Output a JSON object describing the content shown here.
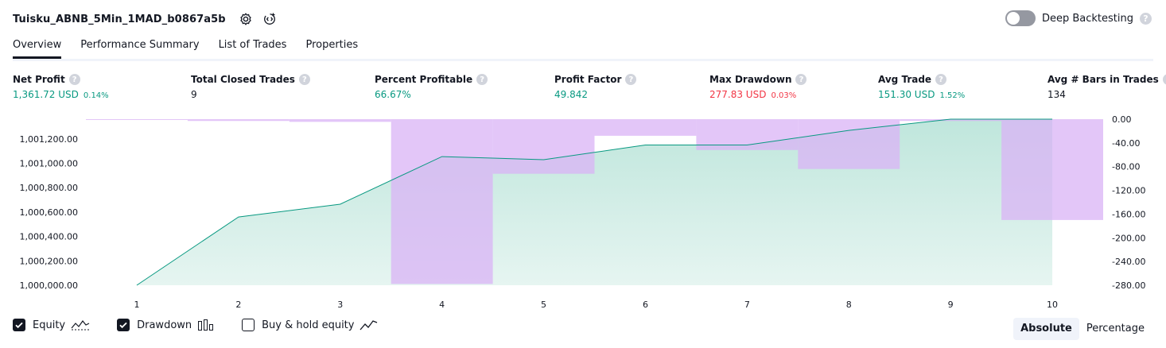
{
  "header": {
    "strategy_name": "Tuisku_ABNB_5Min_1MAD_b0867a5b",
    "deep_backtesting_label": "Deep Backtesting",
    "deep_backtesting_on": false
  },
  "tabs": [
    {
      "label": "Overview",
      "active": true
    },
    {
      "label": "Performance Summary",
      "active": false
    },
    {
      "label": "List of Trades",
      "active": false
    },
    {
      "label": "Properties",
      "active": false
    }
  ],
  "metrics": {
    "net_profit": {
      "label": "Net Profit",
      "value": "1,361.72 USD",
      "pct": "0.14%"
    },
    "total_closed_trades": {
      "label": "Total Closed Trades",
      "value": "9"
    },
    "percent_profitable": {
      "label": "Percent Profitable",
      "value": "66.67%"
    },
    "profit_factor": {
      "label": "Profit Factor",
      "value": "49.842"
    },
    "max_drawdown": {
      "label": "Max Drawdown",
      "value": "277.83 USD",
      "pct": "0.03%"
    },
    "avg_trade": {
      "label": "Avg Trade",
      "value": "151.30 USD",
      "pct": "1.52%"
    },
    "avg_bars": {
      "label": "Avg # Bars in Trades",
      "value": "134"
    }
  },
  "chart_data": {
    "type": "line",
    "x": [
      1,
      2,
      3,
      4,
      5,
      6,
      7,
      8,
      9,
      10
    ],
    "x_ticks": [
      "1",
      "2",
      "3",
      "4",
      "5",
      "6",
      "7",
      "8",
      "9",
      "10"
    ],
    "series": [
      {
        "name": "Equity",
        "type": "area",
        "axis": "left",
        "color": "#089981",
        "values": [
          1000000.0,
          1000560.0,
          1000665.0,
          1001055.0,
          1001030.0,
          1001150.0,
          1001150.0,
          1001270.0,
          1001362.0,
          1001362.0
        ]
      },
      {
        "name": "Drawdown",
        "type": "bar",
        "axis": "right",
        "color": "#ce93d8",
        "values": [
          -0.5,
          -3.0,
          -4.5,
          -277.83,
          -92.0,
          -28.0,
          -52.0,
          -84.0,
          -3.0,
          -170.0
        ]
      }
    ],
    "left_axis": {
      "ticks": [
        "1,000,000.00",
        "1,000,200.00",
        "1,000,400.00",
        "1,000,600.00",
        "1,000,800.00",
        "1,001,000.00",
        "1,001,200.00"
      ],
      "tick_values": [
        1000000,
        1000200,
        1000400,
        1000600,
        1000800,
        1001000,
        1001200
      ],
      "range": [
        1000000,
        1001362
      ]
    },
    "right_axis": {
      "ticks": [
        "0.00",
        "-40.00",
        "-80.00",
        "-120.00",
        "-160.00",
        "-200.00",
        "-240.00",
        "-280.00"
      ],
      "tick_values": [
        0,
        -40,
        -80,
        -120,
        -160,
        -200,
        -240,
        -280
      ],
      "range": [
        -280,
        0
      ]
    },
    "grid": false,
    "legend": "bottom-left"
  },
  "legend": [
    {
      "label": "Equity",
      "checked": true,
      "icon": "equity-line-icon"
    },
    {
      "label": "Drawdown",
      "checked": true,
      "icon": "drawdown-bars-icon"
    },
    {
      "label": "Buy & hold equity",
      "checked": false,
      "icon": "buy-hold-line-icon"
    }
  ],
  "mode": {
    "absolute": "Absolute",
    "percentage": "Percentage",
    "active": "Absolute"
  },
  "icons": {
    "settings": "settings-icon",
    "source": "source-code-icon",
    "help": "?"
  },
  "colors": {
    "profit": "#089981",
    "loss": "#f23645",
    "equity_fill": "#d2efe8",
    "drawdown_fill": "#e1bee7"
  }
}
